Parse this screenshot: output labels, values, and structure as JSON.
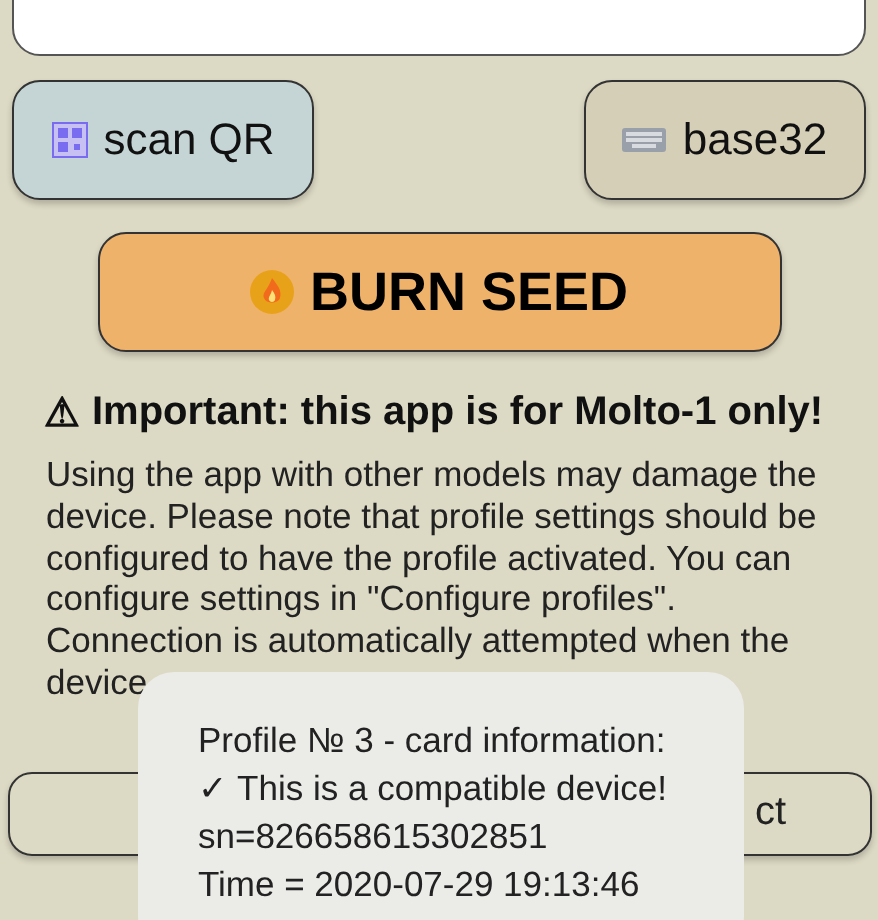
{
  "buttons": [
    {
      "kind": "qr",
      "label": "scan QR"
    },
    {
      "kind": "keyboard",
      "label": "base32"
    }
  ],
  "burn_button": {
    "label": "BURN SEED"
  },
  "warning": {
    "icon": "⚠",
    "title": "Important: this app is for Molto-1 only!"
  },
  "notice": "Using the app with other models may damage the device. Please note that profile settings should be configured to have the profile activated. You can configure settings in \"Configure profiles\". Connection is automatically attempted when the device",
  "connection": {
    "label": "ct"
  },
  "toast": [
    "Profile № 3 - card information:",
    "✓ This is a compatible device!",
    "sn=826658615302851",
    "Time = 2020-07-29 19:13:46"
  ]
}
